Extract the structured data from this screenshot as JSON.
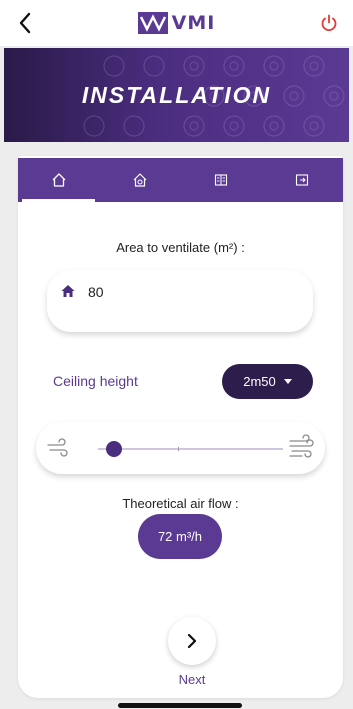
{
  "app": {
    "logo_text": "VMI",
    "brand_color": "#5b3a93",
    "power_color": "#e53935"
  },
  "hero": {
    "title": "INSTALLATION"
  },
  "tabs": [
    {
      "icon": "house-outline-icon",
      "active": true
    },
    {
      "icon": "house-gear-icon",
      "active": false
    },
    {
      "icon": "book-icon",
      "active": false
    },
    {
      "icon": "exit-door-icon",
      "active": false
    }
  ],
  "area": {
    "label": "Area to ventilate (m²) :",
    "value": "80"
  },
  "ceiling": {
    "label": "Ceiling height",
    "selected": "2m50"
  },
  "slider": {
    "level": 0.05
  },
  "air_flow": {
    "label": "Theoretical air flow :",
    "value": "72 m³/h"
  },
  "next": {
    "label": "Next"
  }
}
